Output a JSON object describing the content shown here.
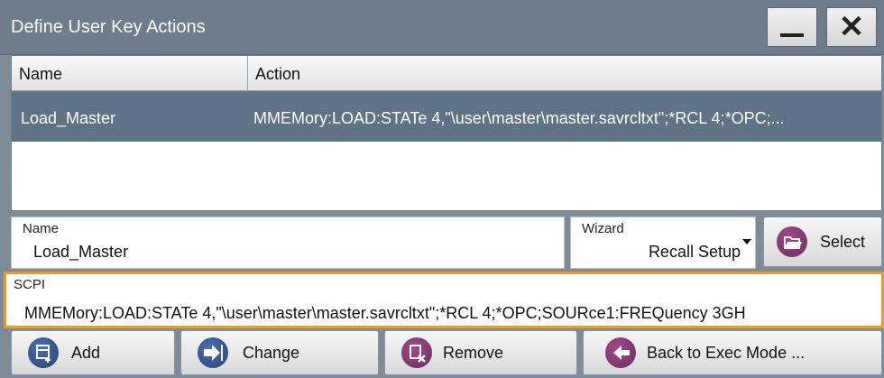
{
  "window": {
    "title": "Define User Key Actions",
    "minimize_icon": "minimize-icon",
    "close_icon": "close-icon"
  },
  "table": {
    "columns": [
      "Name",
      "Action"
    ],
    "rows": [
      {
        "name": "Load_Master",
        "action": "MMEMory:LOAD:STATe 4,\"\\user\\master\\master.savrcltxt\";*RCL 4;*OPC;..."
      }
    ]
  },
  "name_field": {
    "label": "Name",
    "value": "Load_Master"
  },
  "wizard_field": {
    "label": "Wizard",
    "value": "Recall Setup"
  },
  "select_button": {
    "label": "Select",
    "icon": "folder-open-icon"
  },
  "scpi_field": {
    "label": "SCPI",
    "value": "MMEMory:LOAD:STATe 4,\"\\user\\master\\master.savrcltxt\";*RCL 4;*OPC;SOURce1:FREQuency 3GH"
  },
  "buttons": {
    "add": {
      "label": "Add",
      "icon": "add-icon"
    },
    "change": {
      "label": "Change",
      "icon": "arrow-right-icon"
    },
    "remove": {
      "label": "Remove",
      "icon": "remove-icon"
    },
    "back": {
      "label": "Back to Exec Mode ...",
      "icon": "arrow-left-icon"
    }
  },
  "colors": {
    "titlebar": "#6d7d8e",
    "selected_row": "#5f7387",
    "focus_border": "#f29a1c",
    "icon_blue": "#2e4a86",
    "icon_purple": "#7a3068"
  }
}
